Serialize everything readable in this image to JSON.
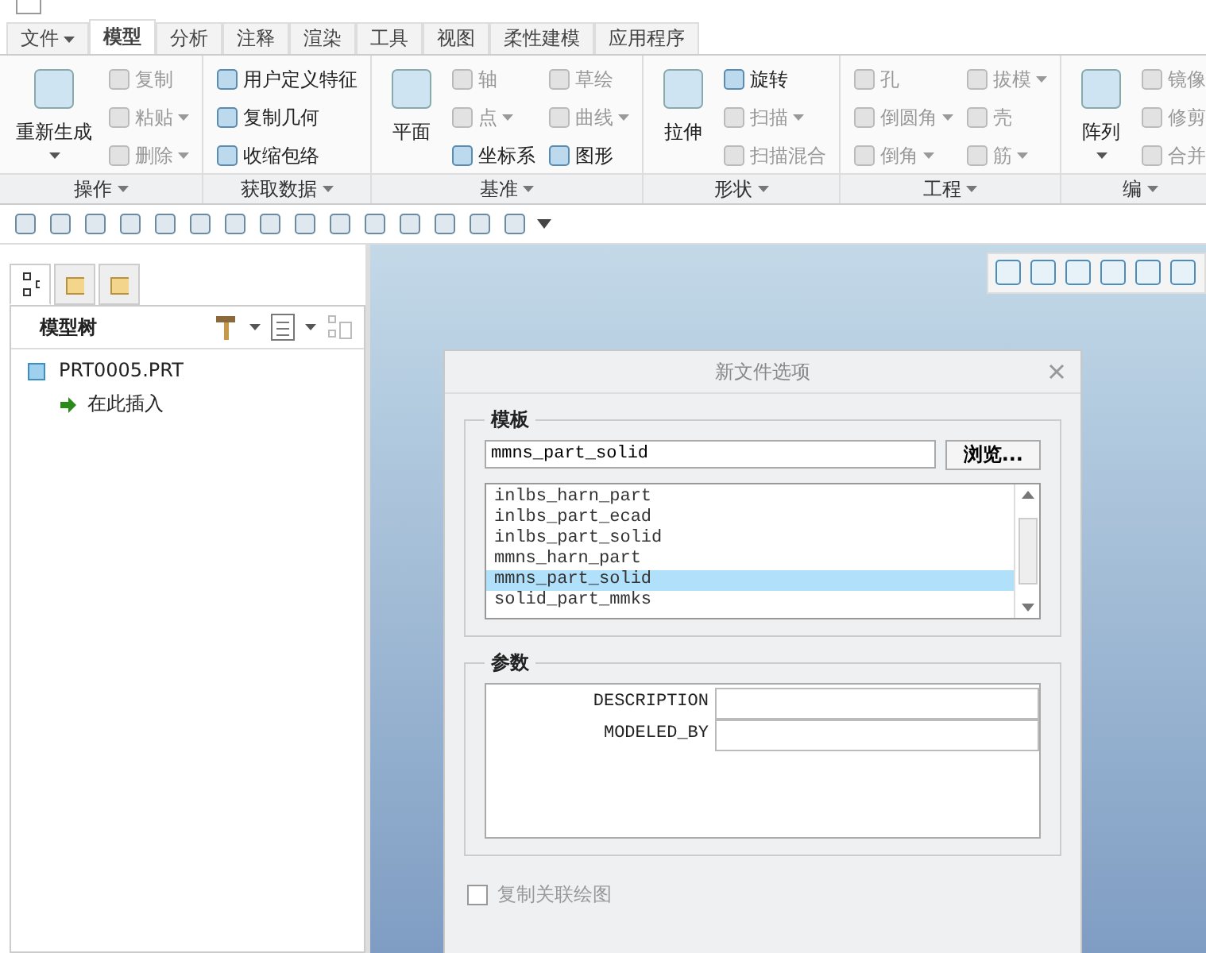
{
  "tabs": [
    {
      "label": "文件",
      "kind": "menu",
      "selected": false
    },
    {
      "label": "模型",
      "kind": "tab",
      "selected": true
    },
    {
      "label": "分析",
      "kind": "tab",
      "selected": false
    },
    {
      "label": "注释",
      "kind": "tab",
      "selected": false
    },
    {
      "label": "渲染",
      "kind": "tab",
      "selected": false
    },
    {
      "label": "工具",
      "kind": "tab",
      "selected": false
    },
    {
      "label": "视图",
      "kind": "tab",
      "selected": false
    },
    {
      "label": "柔性建模",
      "kind": "tab",
      "selected": false
    },
    {
      "label": "应用程序",
      "kind": "tab",
      "selected": false
    }
  ],
  "ribbon": {
    "groups": [
      {
        "label": "操作",
        "items": [
          {
            "kind": "large",
            "label": "重新生成",
            "disabled": false,
            "dropdown": true
          },
          {
            "kind": "small",
            "label": "复制",
            "disabled": true,
            "dropdown": false
          },
          {
            "kind": "small",
            "label": "粘贴",
            "disabled": true,
            "dropdown": true
          },
          {
            "kind": "small",
            "label": "删除",
            "disabled": true,
            "dropdown": true
          }
        ]
      },
      {
        "label": "获取数据",
        "items": [
          {
            "kind": "small",
            "label": "用户定义特征",
            "disabled": false,
            "dropdown": false
          },
          {
            "kind": "small",
            "label": "复制几何",
            "disabled": false,
            "dropdown": false
          },
          {
            "kind": "small",
            "label": "收缩包络",
            "disabled": false,
            "dropdown": false
          }
        ]
      },
      {
        "label": "基准",
        "items": [
          {
            "kind": "large",
            "label": "平面",
            "disabled": false,
            "dropdown": false
          },
          {
            "kind": "small",
            "label": "轴",
            "disabled": true,
            "dropdown": false
          },
          {
            "kind": "small",
            "label": "点",
            "disabled": true,
            "dropdown": true
          },
          {
            "kind": "small",
            "label": "坐标系",
            "disabled": false,
            "dropdown": false
          },
          {
            "kind": "small",
            "label": "草绘",
            "disabled": true,
            "dropdown": false
          },
          {
            "kind": "small",
            "label": "曲线",
            "disabled": true,
            "dropdown": true
          },
          {
            "kind": "small",
            "label": "图形",
            "disabled": false,
            "dropdown": false
          }
        ]
      },
      {
        "label": "形状",
        "items": [
          {
            "kind": "large",
            "label": "拉伸",
            "disabled": false,
            "dropdown": false
          },
          {
            "kind": "small",
            "label": "旋转",
            "disabled": false,
            "dropdown": false
          },
          {
            "kind": "small",
            "label": "扫描",
            "disabled": true,
            "dropdown": true
          },
          {
            "kind": "small",
            "label": "扫描混合",
            "disabled": true,
            "dropdown": false
          }
        ]
      },
      {
        "label": "工程",
        "items": [
          {
            "kind": "small",
            "label": "孔",
            "disabled": true,
            "dropdown": false
          },
          {
            "kind": "small",
            "label": "倒圆角",
            "disabled": true,
            "dropdown": true
          },
          {
            "kind": "small",
            "label": "倒角",
            "disabled": true,
            "dropdown": true
          },
          {
            "kind": "small",
            "label": "拔模",
            "disabled": true,
            "dropdown": true
          },
          {
            "kind": "small",
            "label": "壳",
            "disabled": true,
            "dropdown": false
          },
          {
            "kind": "small",
            "label": "筋",
            "disabled": true,
            "dropdown": true
          }
        ]
      },
      {
        "label": "编",
        "items": [
          {
            "kind": "large",
            "label": "阵列",
            "disabled": false,
            "dropdown": true
          },
          {
            "kind": "small",
            "label": "镜像",
            "disabled": true,
            "dropdown": false
          },
          {
            "kind": "small",
            "label": "修剪",
            "disabled": true,
            "dropdown": false
          },
          {
            "kind": "small",
            "label": "合并",
            "disabled": true,
            "dropdown": false
          }
        ]
      }
    ]
  },
  "model_tree": {
    "panel_tabs": [
      {
        "selected": true
      },
      {
        "selected": false
      },
      {
        "selected": false
      }
    ],
    "title": "模型树",
    "items": [
      {
        "label": "PRT0005.PRT",
        "children": [
          {
            "label": "在此插入"
          }
        ]
      }
    ]
  },
  "dialog": {
    "title": "新文件选项",
    "template": {
      "legend": "模板",
      "value": "mmns_part_solid",
      "browse": "浏览...",
      "list": [
        {
          "label": "inlbs_harn_part",
          "selected": false
        },
        {
          "label": "inlbs_part_ecad",
          "selected": false
        },
        {
          "label": "inlbs_part_solid",
          "selected": false
        },
        {
          "label": "mmns_harn_part",
          "selected": false
        },
        {
          "label": "mmns_part_solid",
          "selected": true
        },
        {
          "label": "solid_part_mmks",
          "selected": false
        }
      ]
    },
    "parameters": {
      "legend": "参数",
      "rows": [
        {
          "name": "DESCRIPTION"
        },
        {
          "name": "MODELED_BY"
        }
      ]
    },
    "copy_drawing": {
      "label": "复制关联绘图",
      "checked": false,
      "disabled": true
    }
  }
}
